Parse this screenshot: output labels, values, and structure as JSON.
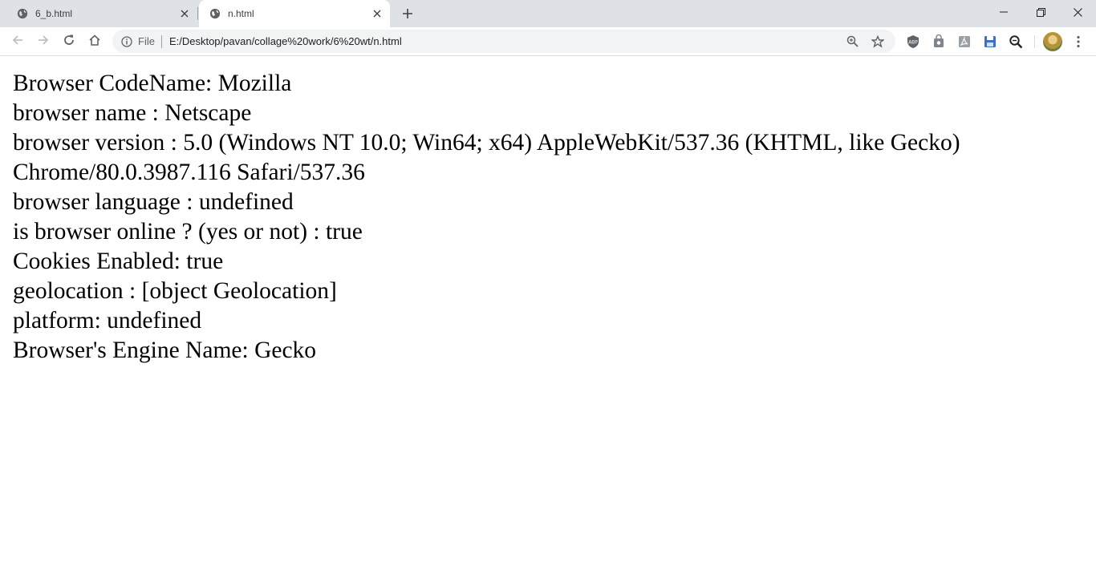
{
  "tabs": [
    {
      "title": "6_b.html",
      "favicon": "globe-icon",
      "active": false
    },
    {
      "title": "n.html",
      "favicon": "globe-icon",
      "active": true
    }
  ],
  "toolbar": {
    "site_info_icon": "info-icon",
    "scheme_label": "File",
    "url": "E:/Desktop/pavan/collage%20work/6%20wt/n.html"
  },
  "page": {
    "lines": [
      "Browser CodeName: Mozilla",
      "browser name : Netscape",
      "browser version : 5.0 (Windows NT 10.0; Win64; x64) AppleWebKit/537.36 (KHTML, like Gecko)",
      "Chrome/80.0.3987.116 Safari/537.36",
      "browser language : undefined",
      "is browser online ? (yes or not) : true",
      "Cookies Enabled: true",
      "geolocation : [object Geolocation]",
      "platform: undefined",
      "Browser's Engine Name: Gecko"
    ]
  },
  "colors": {
    "tabstrip_bg": "#dee1e6",
    "omnibox_bg": "#f1f3f4",
    "icon_color": "#5f6368"
  }
}
